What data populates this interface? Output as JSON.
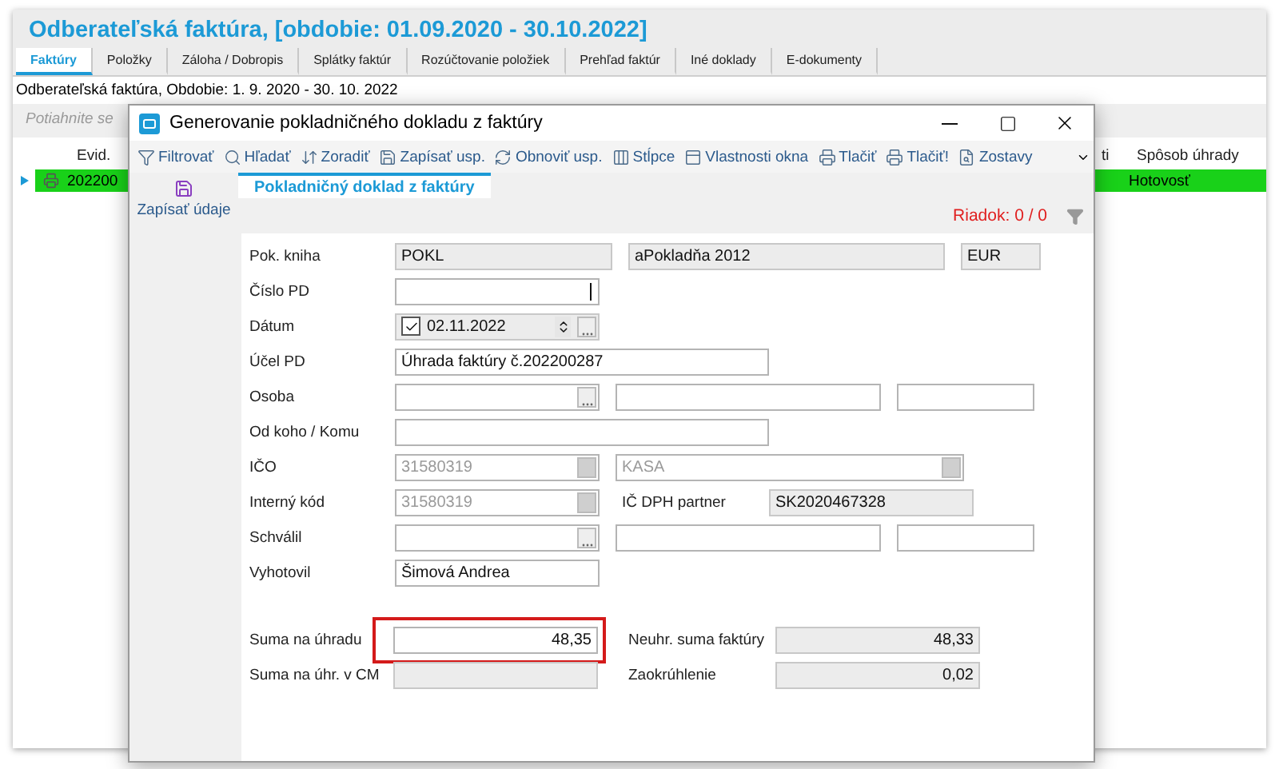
{
  "app": {
    "title": "Odberateľská faktúra, [obdobie: 01.09.2020 - 30.10.2022]",
    "tabs": [
      {
        "label": "Faktúry",
        "selected": true
      },
      {
        "label": "Položky",
        "selected": false
      },
      {
        "label": "Záloha / Dobropis",
        "selected": false
      },
      {
        "label": "Splátky faktúr",
        "selected": false
      },
      {
        "label": "Rozúčtovanie položiek",
        "selected": false
      },
      {
        "label": "Prehľad faktúr",
        "selected": false
      },
      {
        "label": "Iné doklady",
        "selected": false
      },
      {
        "label": "E-dokumenty",
        "selected": false
      }
    ],
    "subtitle": "Odberateľská faktúra, Obdobie: 1. 9. 2020 - 30. 10. 2022",
    "group_hint": "Potiahnite se",
    "grid": {
      "columns": [
        "Evid.",
        "ti",
        "Spôsob úhrady"
      ],
      "rows": [
        {
          "evid": "202200",
          "payment": "Hotovosť",
          "selected": true
        }
      ]
    }
  },
  "dialog": {
    "title": "Generovanie pokladničného dokladu z faktúry",
    "toolbar": [
      {
        "kind": "filter",
        "label": "Filtrovať"
      },
      {
        "kind": "find",
        "label": "Hľadať"
      },
      {
        "kind": "sort",
        "label": "Zoradiť"
      },
      {
        "kind": "save",
        "label": "Zapísať usp."
      },
      {
        "kind": "refresh",
        "label": "Obnoviť usp."
      },
      {
        "kind": "columns",
        "label": "Stĺpce"
      },
      {
        "kind": "window",
        "label": "Vlastnosti okna"
      },
      {
        "kind": "print",
        "label": "Tlačiť"
      },
      {
        "kind": "print2",
        "label": "Tlačiť!"
      },
      {
        "kind": "reports",
        "label": "Zostavy"
      }
    ],
    "side_action": "Zapísať údaje",
    "tabs": [
      {
        "label": "Pokladničný doklad z faktúry",
        "selected": true
      }
    ],
    "row_counter": "Riadok: 0 / 0",
    "rows": [
      {
        "kind": "book",
        "label": "Pok. kniha",
        "values": [
          "POKL",
          "aPokladňa 2012",
          "EUR"
        ]
      },
      {
        "kind": "text",
        "label": "Číslo PD",
        "focused": true
      },
      {
        "kind": "date",
        "label": "Dátum",
        "checked": true,
        "value": "02.11.2022"
      },
      {
        "kind": "wide",
        "label": "Účel PD",
        "value": "Úhrada faktúry č.202200287"
      },
      {
        "kind": "person",
        "label": "Osoba"
      },
      {
        "kind": "wide",
        "label": "Od koho / Komu"
      },
      {
        "kind": "ico",
        "label": "IČO",
        "values": [
          "31580319",
          "KASA"
        ],
        "disabled": true
      },
      {
        "kind": "internal",
        "label": "Interný kód",
        "value": "31580319",
        "disabled": true,
        "partner_label": "IČ DPH partner",
        "partner_value": "SK2020467328"
      },
      {
        "kind": "person",
        "label": "Schválil"
      },
      {
        "kind": "text",
        "label": "Vyhotovil",
        "value": "Šimová Andrea",
        "focused": false
      }
    ],
    "totals": [
      {
        "label": "Suma na úhradu",
        "value": "48,35",
        "highlighted": true,
        "readonly": false,
        "side_label": "Neuhr. suma faktúry",
        "side_value": "48,33"
      },
      {
        "label": "Suma na úhr. v CM",
        "highlighted": false,
        "readonly": true,
        "side_label": "Zaokrúhlenie",
        "side_value": "0,02"
      }
    ]
  }
}
